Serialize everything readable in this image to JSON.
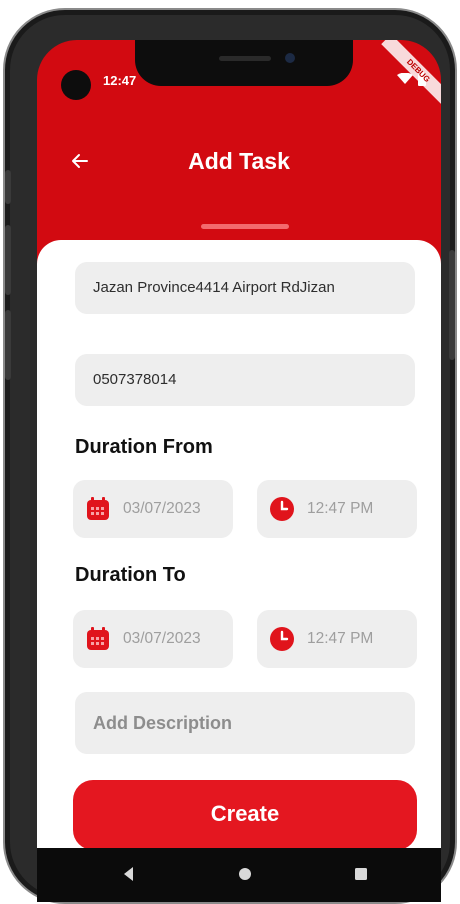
{
  "status_bar": {
    "time": "12:47",
    "debug_banner": "DEBUG"
  },
  "header": {
    "title": "Add Task",
    "back_icon": "arrow-left-icon"
  },
  "form": {
    "address_value": "Jazan Province4414 Airport RdJizan",
    "phone_value": "0507378014",
    "duration_from_label": "Duration From",
    "duration_from_date": "03/07/2023",
    "duration_from_time": "12:47 PM",
    "duration_to_label": "Duration To",
    "duration_to_date": "03/07/2023",
    "duration_to_time": "12:47 PM",
    "description_placeholder": "Add Description",
    "create_label": "Create"
  },
  "colors": {
    "primary": "#d20a11",
    "button": "#e41720",
    "field_bg": "#eeeeee"
  },
  "icons": [
    "arrow-left-icon",
    "calendar-icon",
    "clock-icon",
    "wifi-icon",
    "battery-icon",
    "nav-back-icon",
    "nav-home-icon",
    "nav-recent-icon"
  ]
}
